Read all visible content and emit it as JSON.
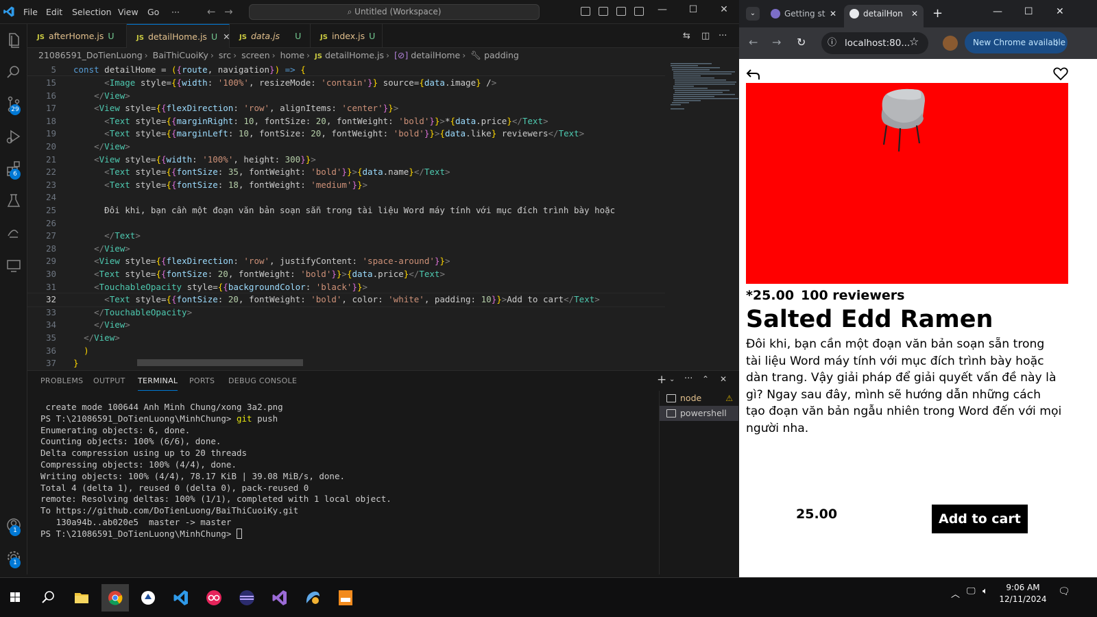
{
  "vscode": {
    "menu": [
      "File",
      "Edit",
      "Selection",
      "View",
      "Go",
      "···"
    ],
    "command_center": "Untitled (Workspace)",
    "tabs": [
      {
        "name": "afterHome.js",
        "status": "U",
        "active": false,
        "italic": false
      },
      {
        "name": "detailHome.js",
        "status": "U",
        "active": true,
        "italic": false
      },
      {
        "name": "data.js",
        "status": "U",
        "active": false,
        "italic": true
      },
      {
        "name": "index.js",
        "status": "U",
        "active": false,
        "italic": false
      }
    ],
    "breadcrumb": [
      "21086591_DoTienLuong",
      "BaiThiCuoiKy",
      "src",
      "screen",
      "home",
      "detailHome.js",
      "detailHome",
      "padding"
    ],
    "activity_badges": {
      "source_control": "29",
      "extensions": "6",
      "accounts": "1",
      "manage": "1"
    },
    "sticky_line": {
      "num": "5",
      "text": "const detailHome = ({route, navigation}) => {"
    },
    "code_lines": [
      {
        "num": "15",
        "text": "      <Image style={{width: '100%', resizeMode: 'contain'}} source={data.image} />"
      },
      {
        "num": "16",
        "text": "    </View>"
      },
      {
        "num": "17",
        "text": "    <View style={{flexDirection: 'row', alignItems: 'center'}}>"
      },
      {
        "num": "18",
        "text": "      <Text style={{marginRight: 10, fontSize: 20, fontWeight: 'bold'}}>*{data.price}</Text>"
      },
      {
        "num": "19",
        "text": "      <Text style={{marginLeft: 10, fontSize: 20, fontWeight: 'bold'}}>{data.like} reviewers</Text>"
      },
      {
        "num": "20",
        "text": "    </View>"
      },
      {
        "num": "21",
        "text": "    <View style={{width: '100%', height: 300}}>"
      },
      {
        "num": "22",
        "text": "      <Text style={{fontSize: 35, fontWeight: 'bold'}}>{data.name}</Text>"
      },
      {
        "num": "23",
        "text": "      <Text style={{fontSize: 18, fontWeight: 'medium'}}>"
      },
      {
        "num": "24",
        "text": ""
      },
      {
        "num": "25",
        "text": "      Đôi khi, bạn cần một đoạn văn bản soạn sẵn trong tài liệu Word máy tính với mục đích trình bày hoặc"
      },
      {
        "num": "26",
        "text": ""
      },
      {
        "num": "27",
        "text": "      </Text>"
      },
      {
        "num": "28",
        "text": "    </View>"
      },
      {
        "num": "29",
        "text": "    <View style={{flexDirection: 'row', justifyContent: 'space-around'}}>"
      },
      {
        "num": "30",
        "text": "    <Text style={{fontSize: 20, fontWeight: 'bold'}}>{data.price}</Text>"
      },
      {
        "num": "31",
        "text": "    <TouchableOpacity style={{backgroundColor: 'black'}}>"
      },
      {
        "num": "32",
        "text": "      <Text style={{fontSize: 20, fontWeight: 'bold', color: 'white', padding: 10}}>Add to cart</Text>"
      },
      {
        "num": "33",
        "text": "    </TouchableOpacity>"
      },
      {
        "num": "34",
        "text": "    </View>"
      },
      {
        "num": "35",
        "text": "  </View>"
      },
      {
        "num": "36",
        "text": "  )"
      },
      {
        "num": "37",
        "text": "}"
      }
    ],
    "current_line": "32",
    "panel_tabs": [
      "PROBLEMS",
      "OUTPUT",
      "TERMINAL",
      "PORTS",
      "DEBUG CONSOLE"
    ],
    "active_panel_tab": "TERMINAL",
    "terminal_lines": [
      " create mode 100644 Anh Minh Chung/xong 3a2.png",
      "PS T:\\21086591_DoTienLuong\\MinhChung> git push",
      "Enumerating objects: 6, done.",
      "Counting objects: 100% (6/6), done.",
      "Delta compression using up to 20 threads",
      "Compressing objects: 100% (4/4), done.",
      "Writing objects: 100% (4/4), 78.17 KiB | 39.08 MiB/s, done.",
      "Total 4 (delta 1), reused 0 (delta 0), pack-reused 0",
      "remote: Resolving deltas: 100% (1/1), completed with 1 local object.",
      "To https://github.com/DoTienLuong/BaiThiCuoiKy.git",
      "   130a94b..ab020e5  master -> master",
      "PS T:\\21086591_DoTienLuong\\MinhChung> "
    ],
    "terminals": [
      {
        "name": "node",
        "warning": true
      },
      {
        "name": "powershell",
        "warning": false
      }
    ]
  },
  "chrome": {
    "tabs": [
      {
        "title": "Getting st",
        "active": false
      },
      {
        "title": "detailHon",
        "active": true
      }
    ],
    "url": "localhost:80...",
    "new_chrome_label": "New Chrome available",
    "accent": "#1a4c85"
  },
  "app": {
    "hero_color": "#ff0000",
    "price_label": "*25.00",
    "reviewers_label": "100 reviewers",
    "product_name": "Salted Edd Ramen",
    "description": "Đôi khi, bạn cần một đoạn văn bản soạn sẵn trong tài liệu Word máy tính với mục đích trình bày hoặc dàn trang. Vậy giải pháp để giải quyết vấn đề này là gì? Ngay sau đây, mình sẽ hướng dẫn những cách tạo đoạn văn bản ngẫu nhiên trong Word đến với mọi người nha.",
    "bottom_price": "25.00",
    "cart_button": "Add to cart"
  },
  "taskbar": {
    "time": "9:06 AM",
    "date": "12/11/2024",
    "apps": [
      "start-icon",
      "search-icon",
      "file-explorer-icon",
      "chrome-icon",
      "app-icon",
      "vscode-icon",
      "app-icon",
      "app-icon",
      "visual-studio-icon",
      "app-icon",
      "pdf-icon"
    ]
  }
}
